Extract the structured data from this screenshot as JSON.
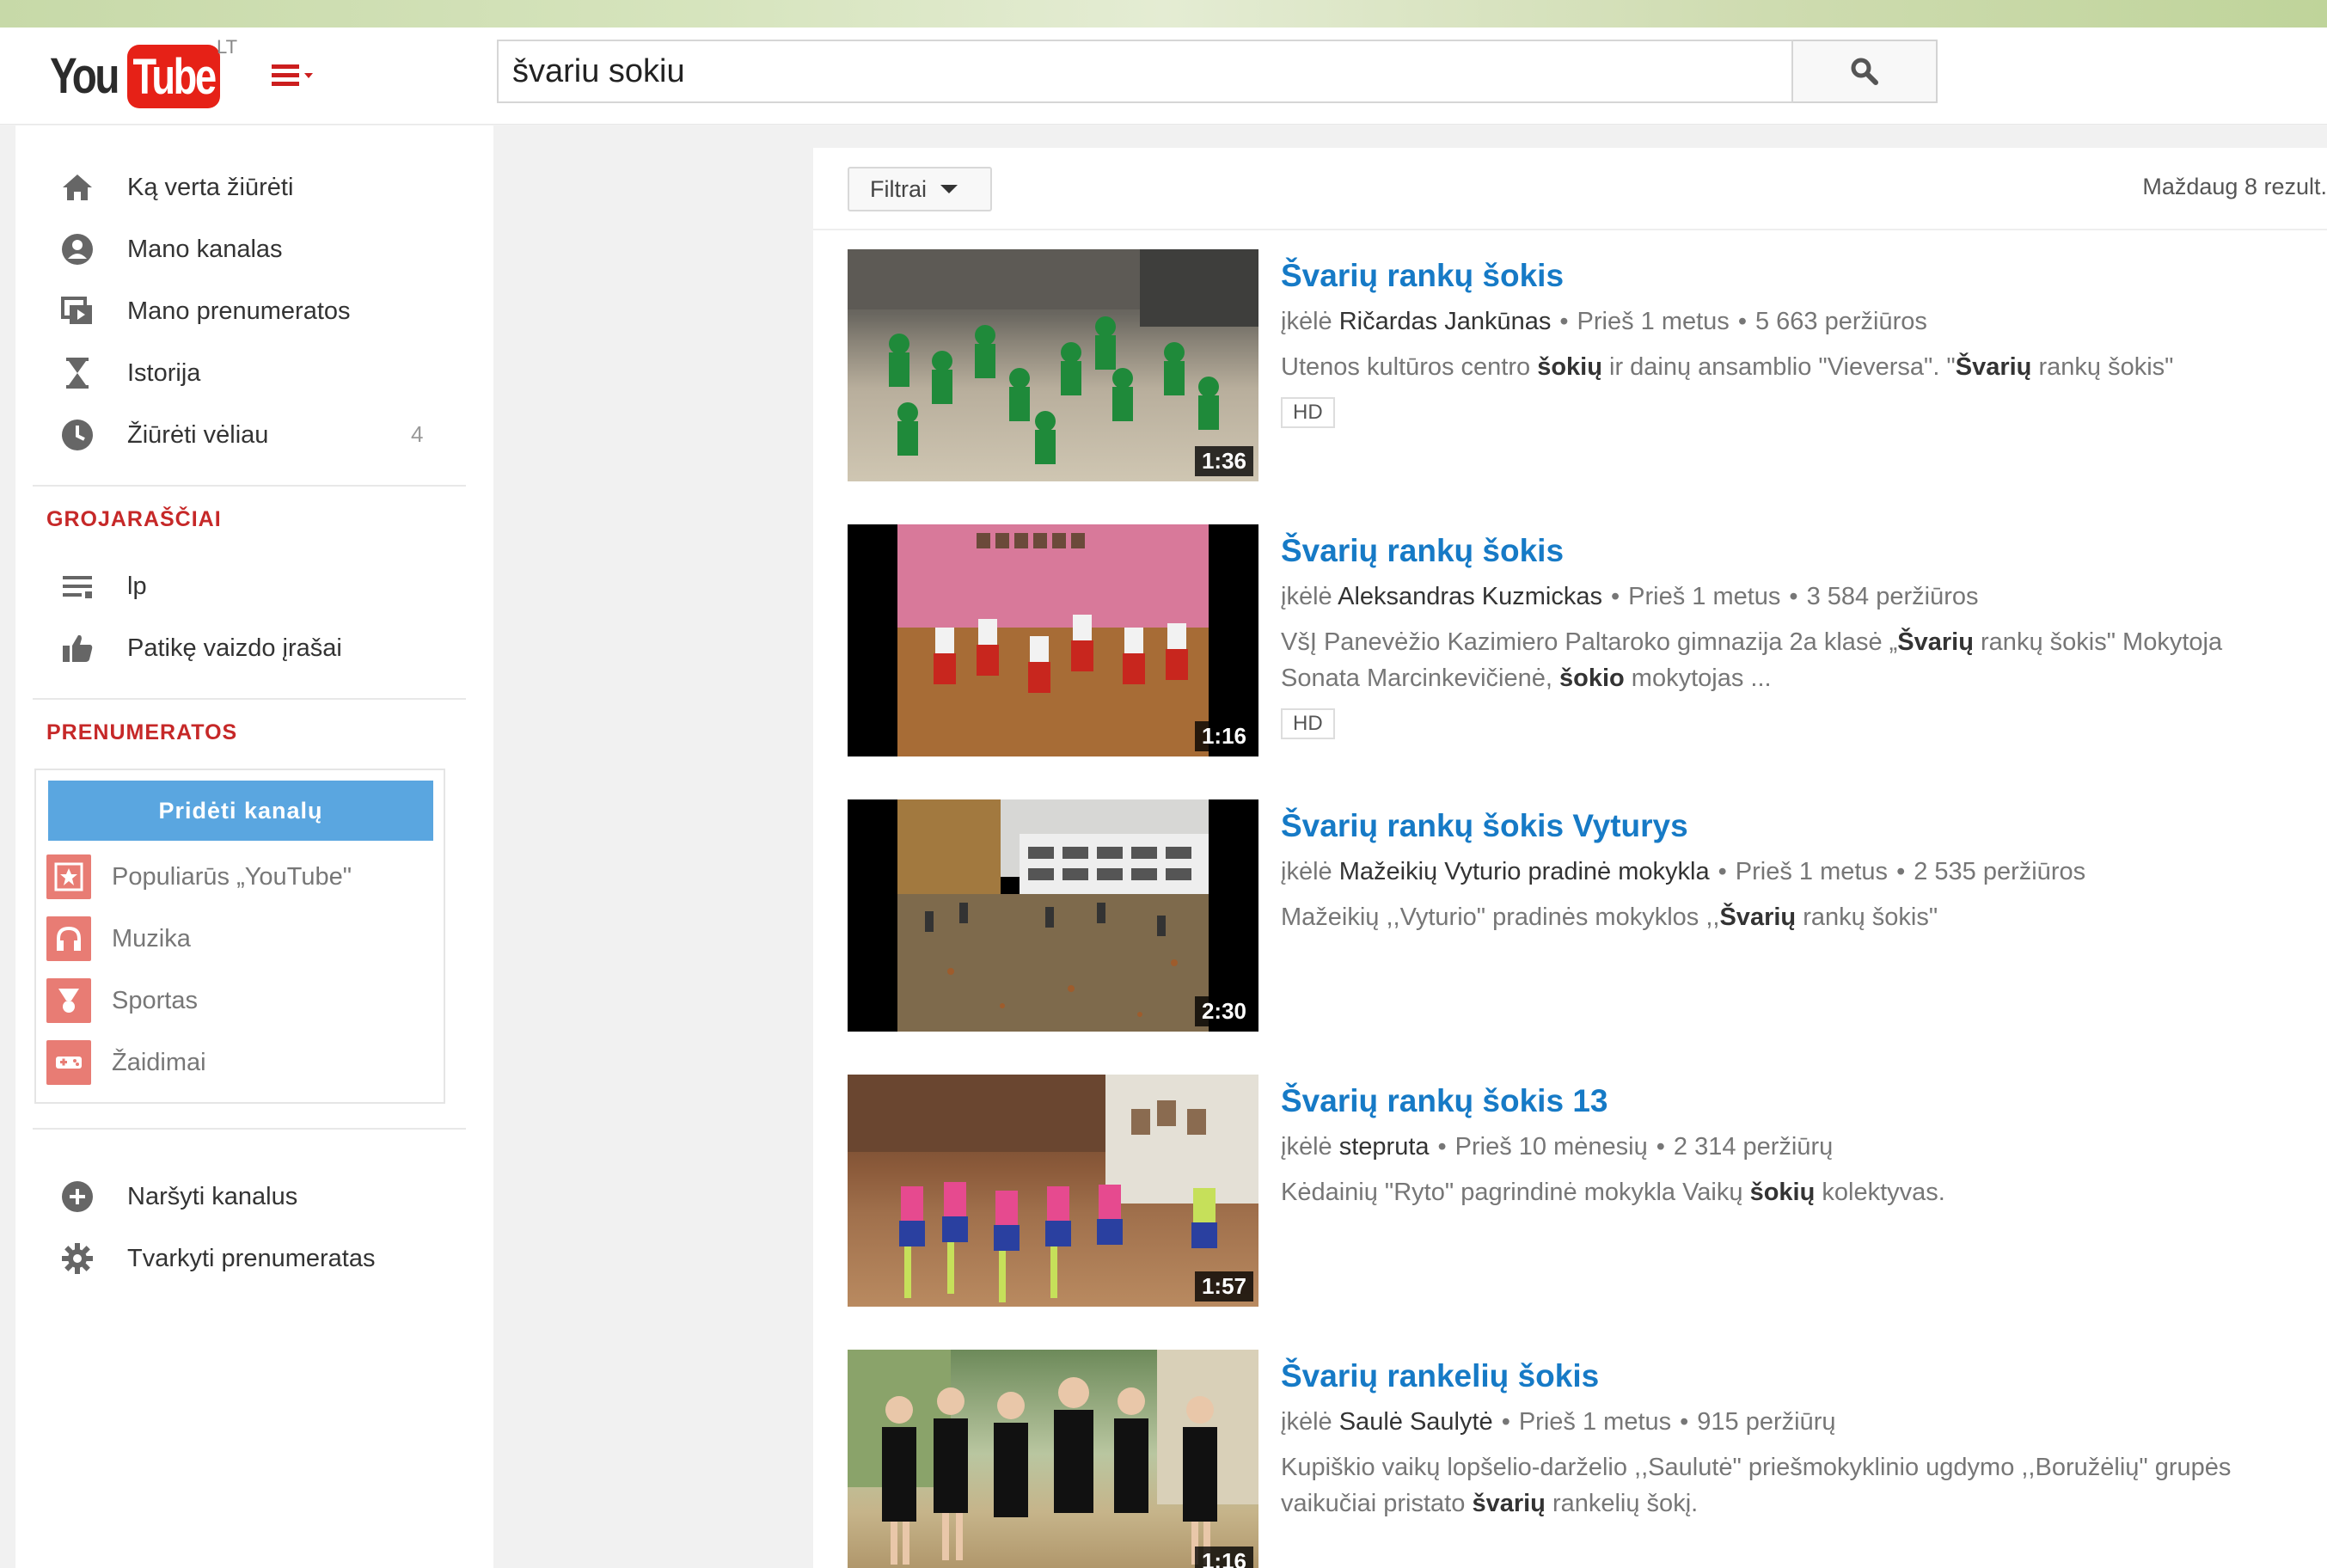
{
  "header": {
    "logo_you": "You",
    "logo_tube": "Tube",
    "country": "LT",
    "search_value": "švariu sokiu"
  },
  "sidebar": {
    "nav": [
      {
        "label": "Ką verta žiūrėti",
        "icon": "home-icon"
      },
      {
        "label": "Mano kanalas",
        "icon": "user-icon"
      },
      {
        "label": "Mano prenumeratos",
        "icon": "subscriptions-icon"
      },
      {
        "label": "Istorija",
        "icon": "hourglass-icon"
      },
      {
        "label": "Žiūrėti vėliau",
        "icon": "clock-icon",
        "count": "4"
      }
    ],
    "playlists_title": "GROJARAŠČIAI",
    "playlists": [
      {
        "label": "lp",
        "icon": "playlist-icon"
      },
      {
        "label": "Patikę vaizdo įrašai",
        "icon": "thumbs-up-icon"
      }
    ],
    "subscriptions_title": "PRENUMERATOS",
    "add_channel_label": "Pridėti kanalų",
    "subscriptions": [
      {
        "label": "Populiarūs „YouTube\"",
        "icon": "star-icon"
      },
      {
        "label": "Muzika",
        "icon": "headphones-icon"
      },
      {
        "label": "Sportas",
        "icon": "medal-icon"
      },
      {
        "label": "Žaidimai",
        "icon": "gamepad-icon"
      }
    ],
    "bottom": [
      {
        "label": "Naršyti kanalus",
        "icon": "plus-circle-icon"
      },
      {
        "label": "Tvarkyti prenumeratas",
        "icon": "gear-icon"
      }
    ]
  },
  "content": {
    "filter_label": "Filtrai",
    "results_count": "Maždaug 8 rezult.",
    "results": [
      {
        "title": "Švarių rankų šokis",
        "uploaded_by": "įkėlė",
        "uploader": "Ričardas Jankūnas",
        "age": "Prieš 1 metus",
        "views": "5 663 peržiūros",
        "desc_a": "Utenos kultūros centro ",
        "desc_b": "šokių",
        "desc_c": " ir dainų ansamblio \"Vieversa\". \"",
        "desc_d": "Švarių",
        "desc_e": " rankų šokis\"",
        "hd": "HD",
        "duration": "1:36"
      },
      {
        "title": "Švarių rankų šokis",
        "uploaded_by": "įkėlė",
        "uploader": "Aleksandras Kuzmickas",
        "age": "Prieš 1 metus",
        "views": "3 584 peržiūros",
        "desc_a": "VšĮ Panevėžio Kazimiero Paltaroko gimnazija 2a klasė „",
        "desc_b": "Švarių",
        "desc_c": " rankų šokis\" Mokytoja Sonata Marcinkevičienė, ",
        "desc_d": "šokio",
        "desc_e": " mokytojas ...",
        "hd": "HD",
        "duration": "1:16"
      },
      {
        "title": "Švarių rankų šokis Vyturys",
        "uploaded_by": "įkėlė",
        "uploader": "Mažeikių Vyturio pradinė mokykla",
        "age": "Prieš 1 metus",
        "views": "2 535 peržiūros",
        "desc_a": "Mažeikių ,,Vyturio\" pradinės mokyklos ,,",
        "desc_b": "Švarių",
        "desc_c": " rankų šokis\"",
        "desc_d": "",
        "desc_e": "",
        "duration": "2:30"
      },
      {
        "title": "Švarių rankų šokis 13",
        "uploaded_by": "įkėlė",
        "uploader": "stepruta",
        "age": "Prieš 10 mėnesių",
        "views": "2 314 peržiūrų",
        "desc_a": "Kėdainių \"Ryto\" pagrindinė mokykla Vaikų ",
        "desc_b": "šokių",
        "desc_c": " kolektyvas.",
        "desc_d": "",
        "desc_e": "",
        "duration": "1:57"
      },
      {
        "title": "Švarių rankelių šokis",
        "uploaded_by": "įkėlė",
        "uploader": "Saulė Saulytė",
        "age": "Prieš 1 metus",
        "views": "915 peržiūrų",
        "desc_a": "Kupiškio vaikų lopšelio-darželio ,,Saulutė\" priešmokyklinio ugdymo ,,Boružėlių\" grupės vaikučiai pristato ",
        "desc_b": "švarių",
        "desc_c": " rankelių šokį.",
        "desc_d": "",
        "desc_e": "",
        "duration": "1:16"
      }
    ]
  }
}
